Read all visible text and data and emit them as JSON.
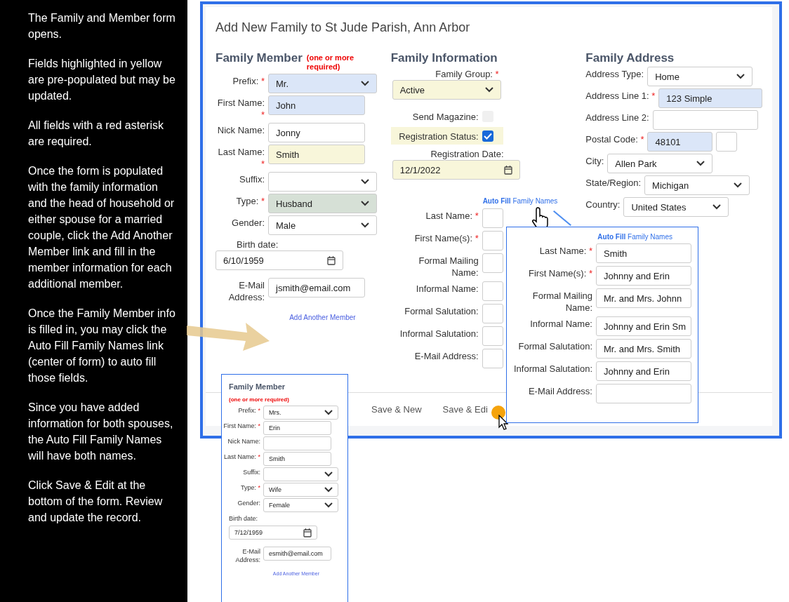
{
  "instructions": [
    "The Family and Member form opens.",
    "Fields highlighted in yellow are pre-populated but may be updated.",
    "All fields with a red asterisk are required.",
    "Once the form is populated with the family information and  the head of household or either spouse for  a married couple, click the Add Another Member link and fill in the member information for each additional member.",
    "Once the Family Member info is filled in, you may click the Auto Fill Family Names link (center of form) to auto fill  those fields.",
    "Since you have added information for both spouses, the Auto Fill Family Names will have both names.",
    "Click Save & Edit at the bottom of the form. Review and update the record."
  ],
  "form": {
    "title": "Add New Family to St Jude Parish, Ann Arbor",
    "member": {
      "heading": "Family Member",
      "note": "(one or more required)",
      "fields": [
        {
          "label": "Prefix:",
          "required_mark": "*",
          "kind": "select",
          "value": "Mr.",
          "color": "#dbe6f8"
        },
        {
          "label": "First Name:",
          "required_mark": "*",
          "kind": "text",
          "value": "John",
          "color": "#dbe6f8"
        },
        {
          "label": "Nick Name:",
          "kind": "text",
          "value": "Jonny"
        },
        {
          "label": "Last Name:",
          "required_mark": "*",
          "kind": "text",
          "value": "Smith",
          "color": "#f8f6da"
        },
        {
          "label": "Suffix:",
          "kind": "select"
        },
        {
          "label": "Type:",
          "required_mark": "*",
          "kind": "select",
          "value": "Husband",
          "color": "#d6e0d6"
        },
        {
          "label": "Gender:",
          "kind": "select",
          "value": "Male"
        },
        {
          "label": "Birth date:",
          "kind": "date",
          "value": "6/10/1959"
        },
        {
          "label": "E-Mail Address:",
          "kind": "text",
          "value": "jsmith@email.com"
        }
      ],
      "add_link": "Add Another Member"
    },
    "info": {
      "heading": "Family Information",
      "fields": [
        {
          "label": "Family Group:",
          "required_mark": "*",
          "kind": "combo",
          "value": "Active",
          "color": "#f8f6da"
        },
        {
          "label": "Send Magazine:",
          "kind": "checkbox",
          "checked": false
        },
        {
          "label": "Registration Status:",
          "kind": "checkbox",
          "checked": true,
          "color": "#f8f6da"
        },
        {
          "label": "Registration Date:",
          "kind": "date",
          "value": "12/1/2022",
          "color": "#f8f6da"
        }
      ],
      "autofill": {
        "bold": "Auto Fill",
        "rest": "Family Names"
      },
      "name_fields": [
        {
          "label": "Last Name:",
          "required_mark": "*",
          "kind": "text"
        },
        {
          "label": "First Name(s):",
          "required_mark": "*",
          "kind": "text"
        },
        {
          "label": "Formal Mailing Name:",
          "kind": "text"
        },
        {
          "label": "Informal Name:",
          "kind": "text"
        },
        {
          "label": "Formal Salutation:",
          "kind": "text"
        },
        {
          "label": "Informal Salutation:",
          "kind": "text"
        },
        {
          "label": "E-Mail Address:",
          "kind": "text"
        }
      ]
    },
    "address": {
      "heading": "Family Address",
      "fields": [
        {
          "label": "Address Type:",
          "kind": "select",
          "value": "Home"
        },
        {
          "label": "Address Line 1:",
          "required_mark": "*",
          "kind": "text",
          "value": "123 Simple",
          "color": "#dbe6f8"
        },
        {
          "label": "Address Line 2:",
          "kind": "text"
        },
        {
          "label": "Postal Code:",
          "required_mark": "*",
          "kind": "zip",
          "value": "48101",
          "color": "#dbe6f8"
        },
        {
          "label": "City:",
          "kind": "select",
          "value": "Allen Park"
        },
        {
          "label": "State/Region:",
          "kind": "select",
          "value": "Michigan"
        },
        {
          "label": "Country:",
          "kind": "select",
          "value": "United States"
        }
      ]
    },
    "buttons": [
      "Save & New",
      "Save & Edi"
    ]
  },
  "popup": {
    "autofill": {
      "bold": "Auto Fill",
      "rest": "Family Names"
    },
    "fields": [
      {
        "label": "Last Name:",
        "required_mark": "*",
        "kind": "text",
        "value": "Smith"
      },
      {
        "label": "First Name(s):",
        "required_mark": "*",
        "kind": "text",
        "value": "Johnny and Erin"
      },
      {
        "label": "Formal Mailing Name:",
        "kind": "text",
        "value": "Mr. and Mrs. Johnn"
      },
      {
        "label": "Informal Name:",
        "kind": "text",
        "value": "Johnny and Erin Sm"
      },
      {
        "label": "Formal Salutation:",
        "kind": "text",
        "value": "Mr. and Mrs. Smith"
      },
      {
        "label": "Informal Salutation:",
        "kind": "text",
        "value": "Johnny and Erin"
      },
      {
        "label": "E-Mail Address:",
        "kind": "text"
      }
    ]
  },
  "inset": {
    "heading": "Family Member",
    "note": "(one or more required)",
    "fields": [
      {
        "label": "Prefix:",
        "required_mark": "*",
        "kind": "select",
        "value": "Mrs."
      },
      {
        "label": "First Name:",
        "required_mark": "*",
        "kind": "text",
        "value": "Erin"
      },
      {
        "label": "Nick Name:",
        "kind": "text"
      },
      {
        "label": "Last Name:",
        "required_mark": "*",
        "kind": "text",
        "value": "Smith"
      },
      {
        "label": "Suffix:",
        "kind": "select"
      },
      {
        "label": "Type:",
        "required_mark": "*",
        "kind": "select",
        "value": "Wife"
      },
      {
        "label": "Gender:",
        "kind": "select",
        "value": "Female"
      },
      {
        "label": "Birth date:",
        "kind": "date",
        "value": "7/12/1959"
      },
      {
        "label": "E-Mail Address:",
        "kind": "text",
        "value": "esmith@email.com"
      }
    ],
    "add_link": "Add Another Member"
  }
}
